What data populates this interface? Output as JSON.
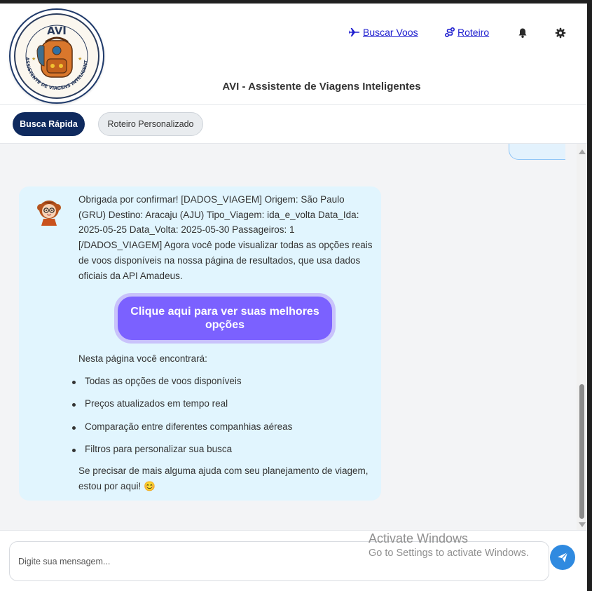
{
  "header": {
    "logo_text": "AVI",
    "logo_caption": "ASSISTENTE DE VIAGENS INTELIGENTE",
    "nav": [
      {
        "label": "Buscar Voos",
        "icon": "airplane-icon"
      },
      {
        "label": "Roteiro",
        "icon": "route-icon"
      }
    ],
    "actions": [
      "bell-icon",
      "gear-icon"
    ]
  },
  "app_title": "AVI - Assistente de Viagens Inteligentes",
  "tabs": {
    "quick": "Busca Rápida",
    "custom": "Roteiro Personalizado"
  },
  "chat": {
    "bot_message": {
      "intro": "Obrigada por confirmar! [DADOS_VIAGEM] Origem: São Paulo (GRU) Destino: Aracaju (AJU) Tipo_Viagem: ida_e_volta Data_Ida: 2025-05-25 Data_Volta: 2025-05-30 Passageiros: 1 [/DADOS_VIAGEM] Agora você pode visualizar todas as opções reais de voos disponíveis na nossa página de resultados, que usa dados oficiais da API Amadeus.",
      "cta_label": "Clique aqui para ver suas melhores opções",
      "list_intro": "Nesta página você encontrará:",
      "features": [
        "Todas as opções de voos disponíveis",
        "Preços atualizados em tempo real",
        "Comparação entre diferentes companhias aéreas",
        "Filtros para personalizar sua busca"
      ],
      "closing": "Se precisar de mais alguma ajuda com seu planejamento de viagem, estou por aqui! 😊"
    }
  },
  "composer": {
    "placeholder": "Digite sua mensagem..."
  },
  "watermark": {
    "line1": "Activate Windows",
    "line2": "Go to Settings to activate Windows."
  },
  "colors": {
    "primary_dark": "#0f2a5e",
    "cta": "#7b61ff",
    "bot_bubble": "#e1f5fe",
    "send": "#2f8ae0",
    "link": "#1d1dcf"
  }
}
